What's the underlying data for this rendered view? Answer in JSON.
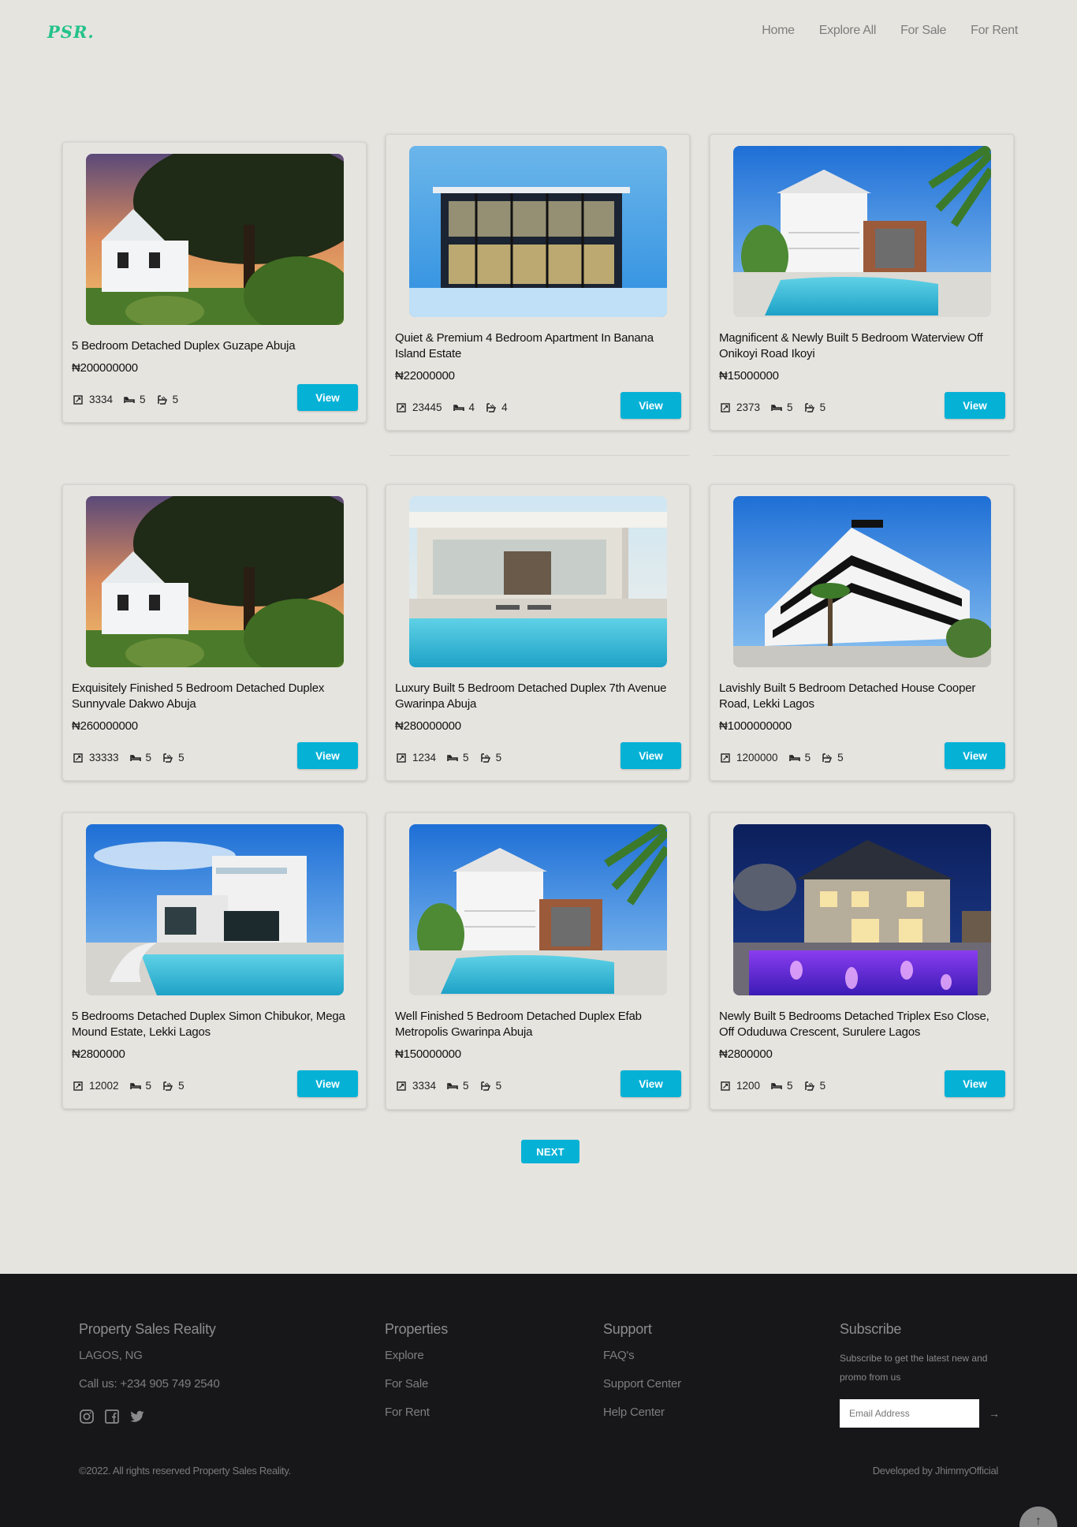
{
  "brand": {
    "logo": "PSR."
  },
  "nav": {
    "items": [
      "Home",
      "Explore All",
      "For Sale",
      "For Rent"
    ]
  },
  "listings": [
    {
      "title": "5 Bedroom Detached Duplex Guzape Abuja",
      "price": "₦200000000",
      "area": "3334",
      "beds": "5",
      "baths": "5",
      "image": "cottage-sunset-photo",
      "view_label": "View"
    },
    {
      "title": "Quiet & Premium 4 Bedroom Apartment In Banana Island Estate",
      "price": "₦22000000",
      "area": "23445",
      "beds": "4",
      "baths": "4",
      "image": "modern-glass-house-photo",
      "view_label": "View"
    },
    {
      "title": "Magnificent & Newly Built 5 Bedroom Waterview Off Onikoyi Road Ikoyi",
      "price": "₦15000000",
      "area": "2373",
      "beds": "5",
      "baths": "5",
      "image": "white-villa-pool-palm-photo",
      "view_label": "View"
    },
    {
      "title": "Exquisitely Finished 5 Bedroom Detached Duplex Sunnyvale Dakwo Abuja",
      "price": "₦260000000",
      "area": "33333",
      "beds": "5",
      "baths": "5",
      "image": "cottage-sunset-photo",
      "view_label": "View"
    },
    {
      "title": "Luxury Built 5 Bedroom Detached Duplex 7th Avenue Gwarinpa Abuja",
      "price": "₦280000000",
      "area": "1234",
      "beds": "5",
      "baths": "5",
      "image": "modern-pool-house-photo",
      "view_label": "View"
    },
    {
      "title": "Lavishly Built 5 Bedroom Detached House Cooper Road, Lekki Lagos",
      "price": "₦1000000000",
      "area": "1200000",
      "beds": "5",
      "baths": "5",
      "image": "white-apartment-block-photo",
      "view_label": "View"
    },
    {
      "title": "5 Bedrooms Detached Duplex Simon Chibukor, Mega Mound Estate, Lekki Lagos",
      "price": "₦2800000",
      "area": "12002",
      "beds": "5",
      "baths": "5",
      "image": "cube-villa-pool-photo",
      "view_label": "View"
    },
    {
      "title": "Well Finished 5 Bedroom Detached Duplex Efab Metropolis Gwarinpa Abuja",
      "price": "₦150000000",
      "area": "3334",
      "beds": "5",
      "baths": "5",
      "image": "white-villa-pool-palm-photo",
      "view_label": "View"
    },
    {
      "title": "Newly Built 5 Bedrooms Detached Triplex Eso Close, Off Oduduwa Crescent, Surulere Lagos",
      "price": "₦2800000",
      "area": "1200",
      "beds": "5",
      "baths": "5",
      "image": "night-house-purple-pool-photo",
      "view_label": "View"
    }
  ],
  "pagination": {
    "next_label": "NEXT"
  },
  "footer": {
    "company": {
      "heading": "Property Sales Reality",
      "location": "LAGOS, NG",
      "phone": "Call us: +234 905 749 2540",
      "social_icons": [
        "instagram-icon",
        "facebook-icon",
        "twitter-icon"
      ]
    },
    "properties": {
      "heading": "Properties",
      "links": [
        "Explore",
        "For Sale",
        "For Rent"
      ]
    },
    "support": {
      "heading": "Support",
      "links": [
        "FAQ's",
        "Support Center",
        "Help Center"
      ]
    },
    "subscribe": {
      "heading": "Subscribe",
      "text": "Subscribe to get the latest new and promo from us",
      "placeholder": "Email Address",
      "submit_icon": "arrow-right-icon"
    },
    "copyright": "©2022. All rights reserved Property Sales Reality.",
    "developer": "Developed by JhimmyOfficial"
  },
  "colors": {
    "accent": "#06b1d6",
    "logo": "#23c28b",
    "background": "#e6e4df",
    "footer": "#171619"
  }
}
